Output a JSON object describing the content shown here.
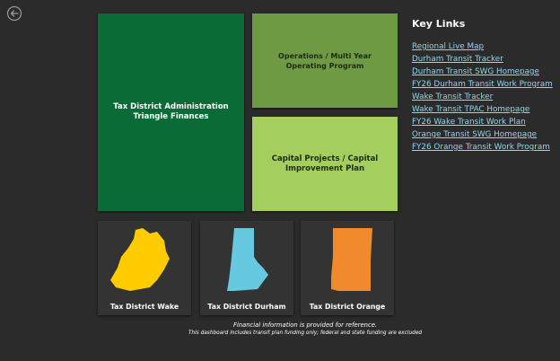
{
  "tiles": {
    "admin": "Tax District Administration Triangle Finances",
    "operations": "Operations / Multi Year Operating Program",
    "capital": "Capital Projects / Capital Improvement Plan"
  },
  "key_links": {
    "title": "Key Links",
    "items": [
      "Regional Live Map",
      "Durham Transit Tracker",
      "Durham Transit SWG Homepage",
      "FY26 Durham Transit Work Program",
      "Wake Transit Tracker",
      "Wake Transit TPAC Homepage",
      "FY26 Wake Transit Work Plan",
      "Orange Transit SWG Homepage",
      "FY26 Orange Transit Work Program"
    ]
  },
  "counties": {
    "wake": {
      "label": "Tax District Wake",
      "color": "#ffcc00"
    },
    "durham": {
      "label": "Tax District Durham",
      "color": "#66c9e0"
    },
    "orange": {
      "label": "Tax District Orange",
      "color": "#f08a2c"
    }
  },
  "footer": {
    "line1": "Financial information is provided for reference.",
    "line2": "This dashboard includes transit plan funding only; federal and state funding are excluded"
  },
  "colors": {
    "background": "#2b2b2b",
    "admin_tile": "#0b6b36",
    "operations_tile": "#6e9a44",
    "capital_tile": "#a4cf5e",
    "link": "#8fd8f0"
  },
  "icons": {
    "back": "back-arrow-icon"
  }
}
